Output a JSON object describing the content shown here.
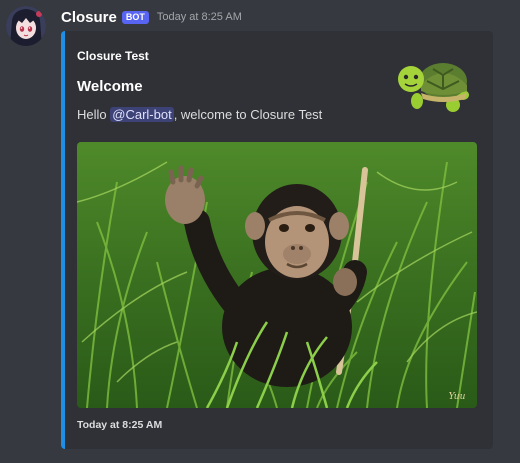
{
  "message": {
    "username": "Closure",
    "bot_tag": "BOT",
    "timestamp": "Today at 8:25 AM",
    "avatar_icon": "anime-avatar",
    "embed": {
      "accent_color": "#1f8fe5",
      "author": "Closure Test",
      "title": "Welcome",
      "description_prefix": "Hello ",
      "mention": "@Carl-bot",
      "description_suffix": ", welcome to Closure Test",
      "thumbnail_icon": "turtle-icon",
      "image_icon": "chimpanzee-in-grass-photo",
      "image_watermark": "Yuu",
      "footer_timestamp": "Today at 8:25 AM"
    }
  }
}
